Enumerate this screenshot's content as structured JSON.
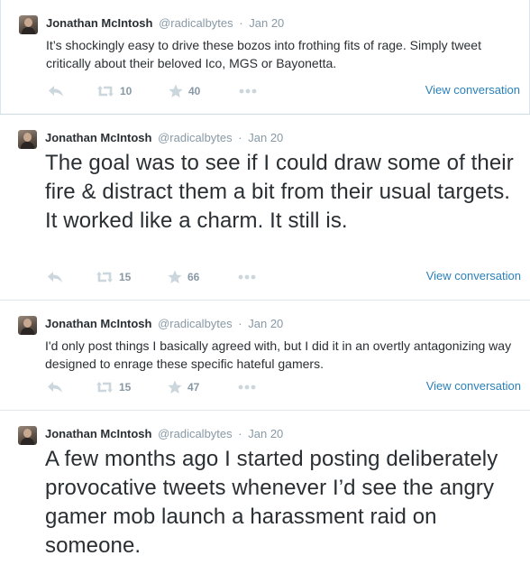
{
  "tweets": [
    {
      "name": "Jonathan McIntosh",
      "handle": "@radicalbytes",
      "separator": "·",
      "date": "Jan 20",
      "text": "It’s shockingly easy to drive these bozos into frothing fits of rage. Simply tweet critically about their beloved Ico, MGS or Bayonetta.",
      "retweets": "10",
      "favorites": "40",
      "view_label": "View conversation"
    },
    {
      "name": "Jonathan McIntosh",
      "handle": "@radicalbytes",
      "separator": "·",
      "date": "Jan 20",
      "text": "The goal was to see if I could draw some of their fire & distract them a bit from their usual targets. It worked like a charm. It still is.",
      "retweets": "15",
      "favorites": "66",
      "view_label": "View conversation"
    },
    {
      "name": "Jonathan McIntosh",
      "handle": "@radicalbytes",
      "separator": "·",
      "date": "Jan 20",
      "text": "I'd only post things I basically agreed with, but I did it in an overtly antagonizing way designed to enrage these specific hateful gamers.",
      "retweets": "15",
      "favorites": "47",
      "view_label": "View conversation"
    },
    {
      "name": "Jonathan McIntosh",
      "handle": "@radicalbytes",
      "separator": "·",
      "date": "Jan 20",
      "text": "A few months ago I started posting deliberately provocative tweets whenever I’d see the angry gamer mob launch a harassment raid on someone."
    }
  ],
  "icons": {
    "reply": "reply-icon",
    "retweet": "retweet-icon",
    "favorite": "star-icon",
    "more": "more-dots-icon"
  },
  "colors": {
    "link": "#2a80b9",
    "muted": "#8899a6",
    "text": "#292f33",
    "icon": "#ccd6dd",
    "divider": "#e1e8ed"
  }
}
